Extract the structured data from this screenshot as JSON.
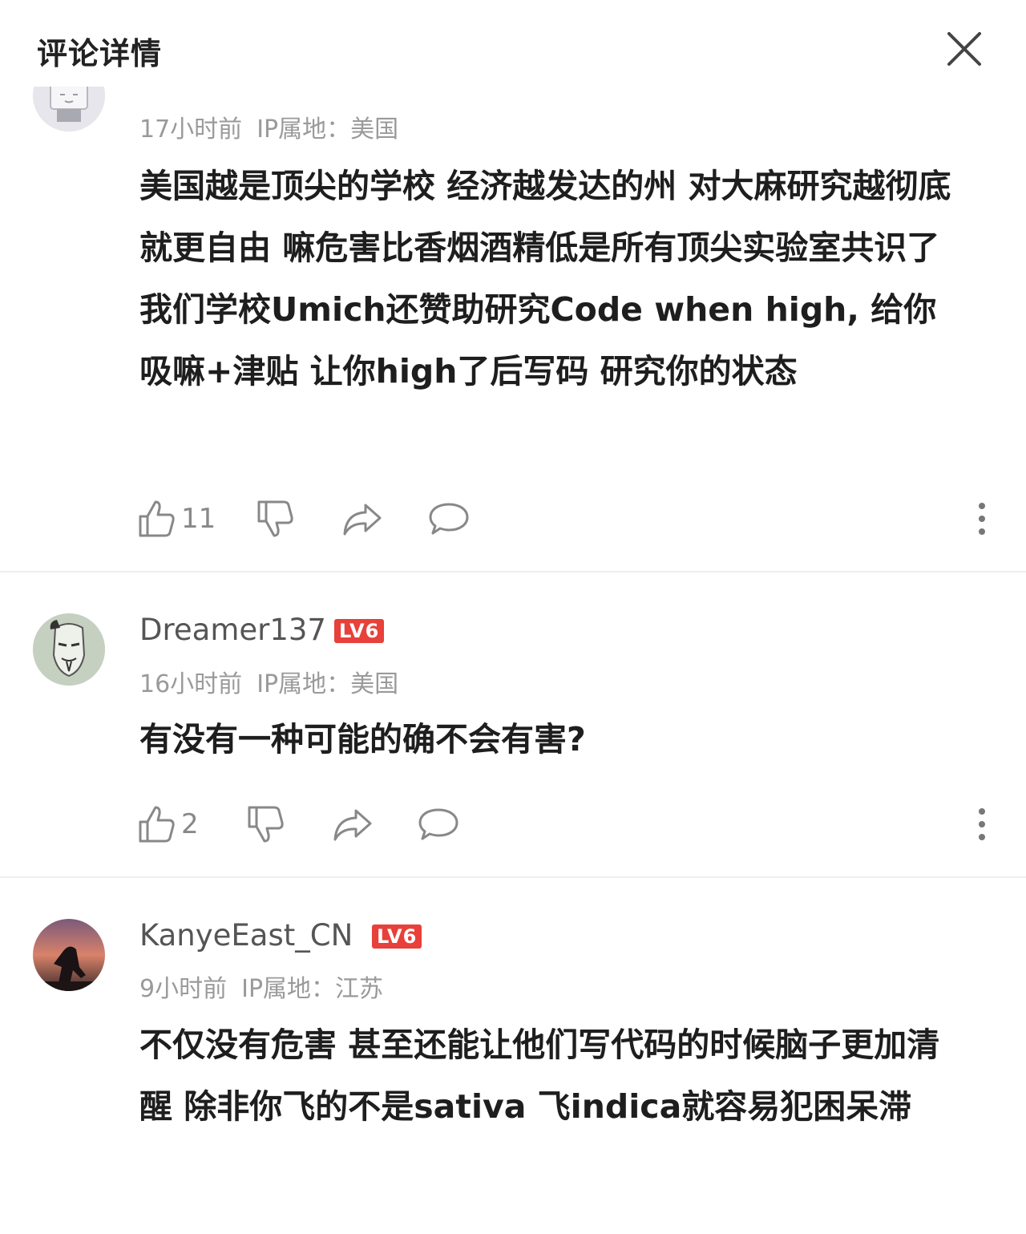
{
  "header": {
    "title": "评论详情"
  },
  "comments": [
    {
      "username": "",
      "level": "",
      "time": "17小时前",
      "ip": "IP属地：美国",
      "text": "美国越是顶尖的学校 经济越发达的州 对大麻研究越彻底 就更自由 嘛危害比香烟酒精低是所有顶尖实验室共识了 我们学校Umich还赞助研究Code when high, 给你吸嘛+津贴 让你high了后写码 研究你的状态",
      "likes": "11"
    },
    {
      "username": "Dreamer137",
      "level": "LV6",
      "time": "16小时前",
      "ip": "IP属地：美国",
      "text": "有没有一种可能的确不会有害?",
      "likes": "2"
    },
    {
      "username": "KanyeEast_CN",
      "level": "LV6",
      "time": "9小时前",
      "ip": "IP属地：江苏",
      "text": "不仅没有危害 甚至还能让他们写代码的时候脑子更加清醒 除非你飞的不是sativa 飞indica就容易犯困呆滞",
      "likes": ""
    }
  ]
}
